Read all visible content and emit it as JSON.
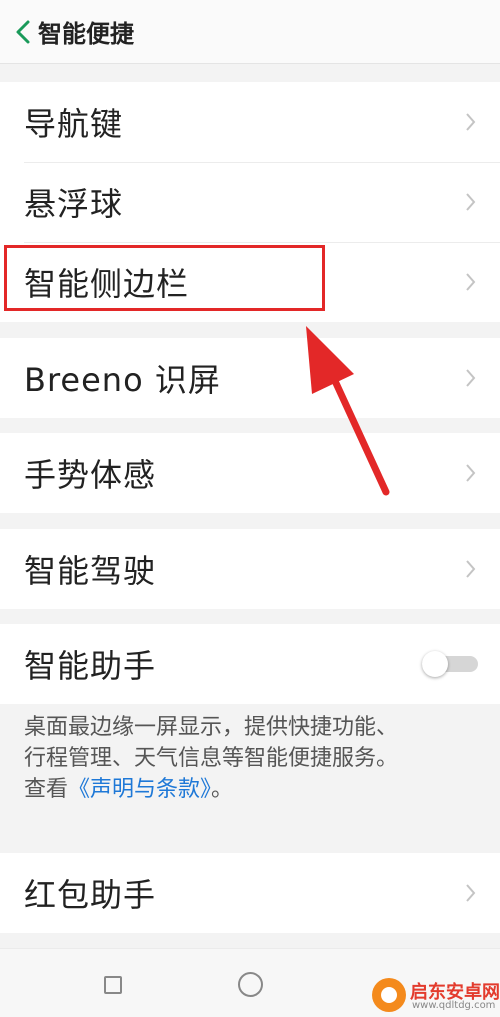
{
  "header": {
    "title": "智能便捷"
  },
  "menu": {
    "navigation_keys": "导航键",
    "floating_ball": "悬浮球",
    "smart_sidebar": "智能侧边栏",
    "breeno_screen": "Breeno 识屏",
    "gesture_motion": "手势体感",
    "smart_driving": "智能驾驶",
    "smart_assistant": "智能助手",
    "red_packet_assistant": "红包助手"
  },
  "smart_assistant": {
    "toggle_on": false,
    "description_line1": "桌面最边缘一屏显示，提供快捷功能、",
    "description_line2": "行程管理、天气信息等智能便捷服务。",
    "description_prefix": "查看",
    "description_link": "《声明与条款》",
    "description_suffix": "。"
  },
  "annotation": {
    "highlight_color": "#e32828"
  },
  "navbar": {
    "icons": [
      "recent-apps-icon",
      "home-icon"
    ]
  },
  "watermark": {
    "name": "启东安卓网",
    "url": "www.qdltdg.com"
  },
  "colors": {
    "background": "#f3f3f3",
    "row": "#ffffff",
    "link": "#1e78d7",
    "accent_back": "#1a9a5a"
  }
}
